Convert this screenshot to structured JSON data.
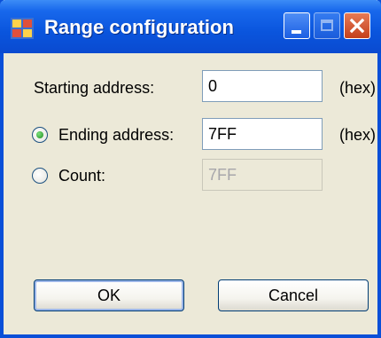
{
  "window": {
    "title": "Range configuration"
  },
  "form": {
    "start_label": "Starting address:",
    "start_value": "0",
    "start_unit": "(hex)",
    "end_label": "Ending address:",
    "end_value": "7FF",
    "end_unit": "(hex)",
    "count_label": "Count:",
    "count_value": "7FF",
    "selected_option": "Ending address"
  },
  "buttons": {
    "ok_label": "OK",
    "cancel_label": "Cancel"
  },
  "colors": {
    "titlebar": "#0a55dd",
    "dialog_bg": "#ece9d8",
    "radio_selected": "#1e8d1e"
  },
  "icons": {
    "app_icon": "app-window-icon",
    "minimize": "minimize-icon",
    "maximize": "maximize-icon",
    "close": "close-icon"
  }
}
